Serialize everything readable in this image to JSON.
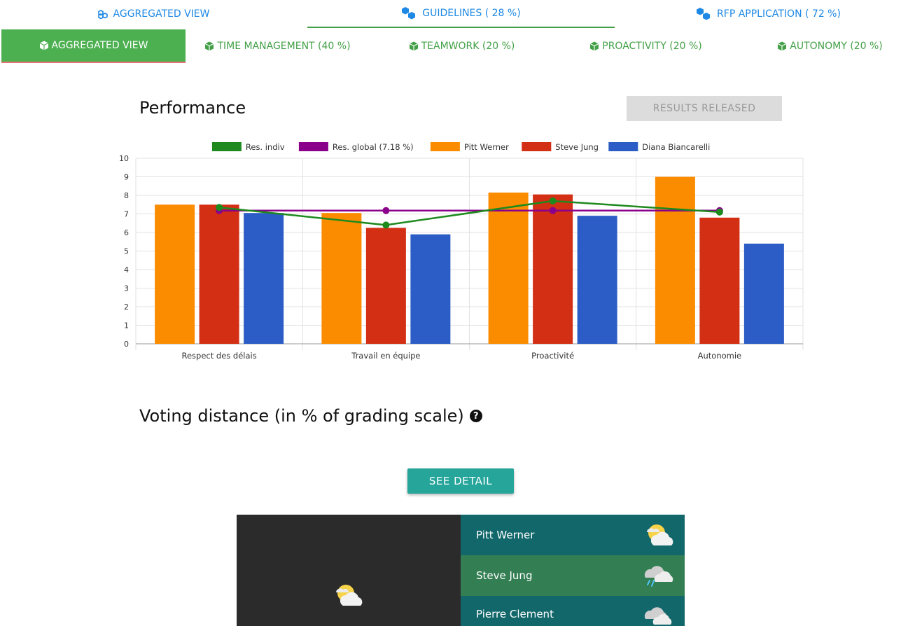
{
  "top_tabs": [
    {
      "label": "AGGREGATED VIEW"
    },
    {
      "label": "GUIDELINES ( 28 %)"
    },
    {
      "label": "RFP APPLICATION ( 72 %)"
    }
  ],
  "sub_tabs": [
    {
      "label": "AGGREGATED VIEW"
    },
    {
      "label": "TIME MANAGEMENT (40 %)"
    },
    {
      "label": "TEAMWORK (20 %)"
    },
    {
      "label": "PROACTIVITY (20 %)"
    },
    {
      "label": "AUTONOMY (20 %)"
    }
  ],
  "performance": {
    "title": "Performance",
    "released_label": "RESULTS RELEASED"
  },
  "chart_data": {
    "type": "bar",
    "categories": [
      "Respect des délais",
      "Travail en équipe",
      "Proactivité",
      "Autonomie"
    ],
    "ylim": [
      0,
      10
    ],
    "yticks": [
      "0",
      "1",
      "2",
      "3",
      "4",
      "5",
      "6",
      "7",
      "8",
      "9",
      "10"
    ],
    "grid": true,
    "legend_position": "top",
    "series": [
      {
        "name": "Pitt Werner",
        "kind": "bar",
        "color": "#fb8c00",
        "values": [
          7.5,
          7.05,
          8.15,
          9.0
        ]
      },
      {
        "name": "Steve Jung",
        "kind": "bar",
        "color": "#d32f14",
        "values": [
          7.5,
          6.25,
          8.05,
          6.8
        ]
      },
      {
        "name": "Diana Biancarelli",
        "kind": "bar",
        "color": "#2c5cc5",
        "values": [
          7.05,
          5.9,
          6.9,
          5.4
        ]
      },
      {
        "name": "Res. indiv",
        "kind": "line",
        "color": "#1e8a1e",
        "values": [
          7.35,
          6.4,
          7.7,
          7.1
        ]
      },
      {
        "name": "Res. global (7.18 %)",
        "kind": "line",
        "color": "#8b008b",
        "values": [
          7.18,
          7.18,
          7.18,
          7.18
        ]
      }
    ],
    "legend_order": [
      3,
      4,
      0,
      1,
      2
    ]
  },
  "voting": {
    "title": "Voting distance (in % of grading scale)",
    "help_icon": "?",
    "detail_label": "SEE DETAIL"
  },
  "people": [
    {
      "name": "Pitt Werner",
      "bg": "#12676b",
      "weather": "sun-cloud"
    },
    {
      "name": "Steve Jung",
      "bg": "#337f53",
      "weather": "rain"
    },
    {
      "name": "Pierre Clement",
      "bg": "#12676b",
      "weather": "cloud"
    }
  ],
  "overall_weather": "sun-cloud"
}
